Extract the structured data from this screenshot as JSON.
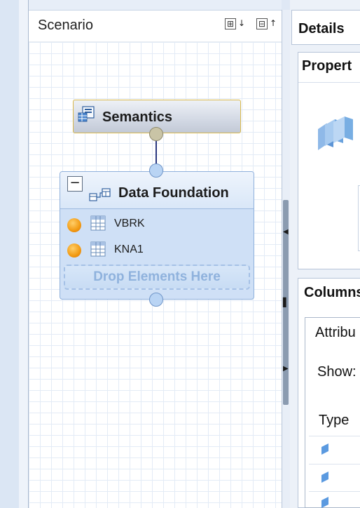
{
  "scenario": {
    "title": "Scenario",
    "expand_icon_text": "⊞",
    "collapse_icon_text": "⊟",
    "expand_arrow": "↓",
    "collapse_arrow": "↑"
  },
  "nodes": {
    "semantics": {
      "label": "Semantics"
    },
    "data_foundation": {
      "collapse_symbol": "−",
      "label": "Data Foundation",
      "tables": [
        {
          "name": "VBRK"
        },
        {
          "name": "KNA1"
        }
      ],
      "drop_hint": "Drop Elements Here"
    }
  },
  "splitter": {
    "left_arrow": "◀",
    "right_arrow": "▶",
    "thumb_marker": "▌"
  },
  "details": {
    "title": "Details",
    "properties_title": "Propert",
    "columns_title": "Columns",
    "attributes_tab": "Attribu",
    "show_label": "Show:",
    "type_header": "Type"
  },
  "colors": {
    "node_border_selected": "#d9b84a",
    "connector": "#2a3880",
    "port": "#b9d4f4",
    "key_dot": "#f29a12"
  }
}
